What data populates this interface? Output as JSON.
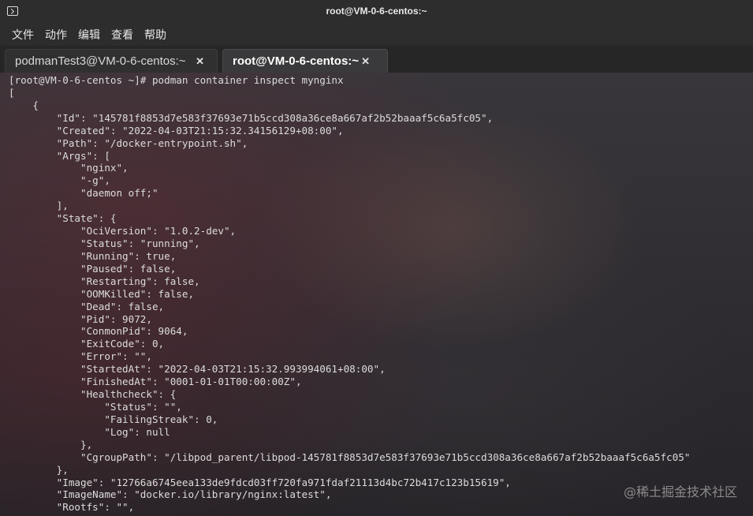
{
  "window": {
    "title": "root@VM-0-6-centos:~"
  },
  "menu": [
    "文件",
    "动作",
    "编辑",
    "查看",
    "帮助"
  ],
  "tabs": [
    {
      "label": "podmanTest3@VM-0-6-centos:~",
      "active": false
    },
    {
      "label": "root@VM-0-6-centos:~",
      "active": true
    }
  ],
  "close_glyph": "✕",
  "terminal_lines": [
    "[root@VM-0-6-centos ~]# podman container inspect mynginx",
    "[",
    "    {",
    "        \"Id\": \"145781f8853d7e583f37693e71b5ccd308a36ce8a667af2b52baaaf5c6a5fc05\",",
    "        \"Created\": \"2022-04-03T21:15:32.34156129+08:00\",",
    "        \"Path\": \"/docker-entrypoint.sh\",",
    "        \"Args\": [",
    "            \"nginx\",",
    "            \"-g\",",
    "            \"daemon off;\"",
    "        ],",
    "        \"State\": {",
    "            \"OciVersion\": \"1.0.2-dev\",",
    "            \"Status\": \"running\",",
    "            \"Running\": true,",
    "            \"Paused\": false,",
    "            \"Restarting\": false,",
    "            \"OOMKilled\": false,",
    "            \"Dead\": false,",
    "            \"Pid\": 9072,",
    "            \"ConmonPid\": 9064,",
    "            \"ExitCode\": 0,",
    "            \"Error\": \"\",",
    "            \"StartedAt\": \"2022-04-03T21:15:32.993994061+08:00\",",
    "            \"FinishedAt\": \"0001-01-01T00:00:00Z\",",
    "            \"Healthcheck\": {",
    "                \"Status\": \"\",",
    "                \"FailingStreak\": 0,",
    "                \"Log\": null",
    "            },",
    "            \"CgroupPath\": \"/libpod_parent/libpod-145781f8853d7e583f37693e71b5ccd308a36ce8a667af2b52baaaf5c6a5fc05\"",
    "        },",
    "        \"Image\": \"12766a6745eea133de9fdcd03ff720fa971fdaf21113d4bc72b417c123b15619\",",
    "        \"ImageName\": \"docker.io/library/nginx:latest\",",
    "        \"Rootfs\": \"\","
  ],
  "watermark": "@稀土掘金技术社区"
}
